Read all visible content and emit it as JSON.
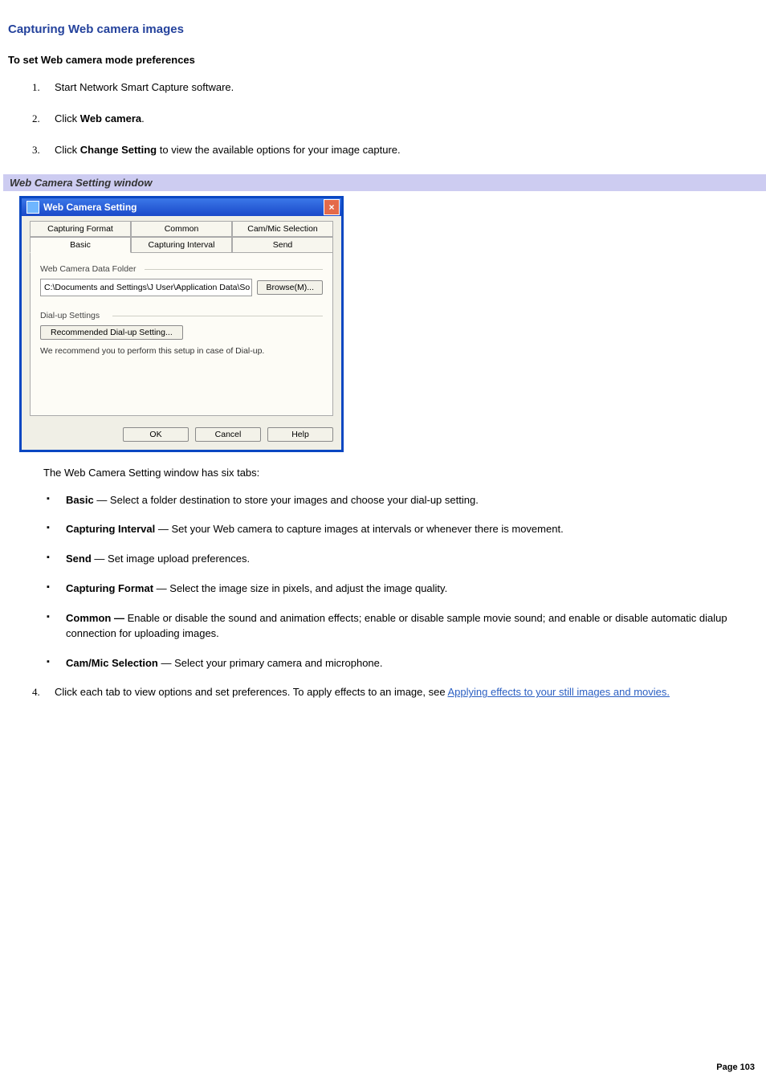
{
  "page": {
    "title": "Capturing Web camera images",
    "subhead": "To set Web camera mode preferences",
    "footer": "Page 103"
  },
  "steps": {
    "s1": "Start Network Smart Capture software.",
    "s2_pre": "Click ",
    "s2_bold": "Web camera",
    "s2_post": ".",
    "s3_pre": "Click ",
    "s3_bold": "Change Setting",
    "s3_post": " to view the available options for your image capture.",
    "s4_pre": "Click each tab to view options and set preferences. To apply effects to an image, see ",
    "s4_link": "Applying effects to your still images and movies."
  },
  "caption": "Web Camera Setting window",
  "dialog": {
    "title": "Web Camera Setting",
    "tabs": {
      "capturing_format": "Capturing Format",
      "common": "Common",
      "cam_mic": "Cam/Mic Selection",
      "basic": "Basic",
      "capturing_interval": "Capturing Interval",
      "send": "Send"
    },
    "group1_label": "Web Camera Data Folder",
    "path_value": "C:\\Documents and Settings\\J User\\Application Data\\So",
    "browse_btn": "Browse(M)...",
    "group2_label": "Dial-up Settings",
    "dialup_btn": "Recommended Dial-up Setting...",
    "dialup_note": "We recommend you to perform this setup in case of Dial-up.",
    "ok": "OK",
    "cancel": "Cancel",
    "help": "Help",
    "close_x": "×"
  },
  "tabs_intro": "The Web Camera Setting window has six tabs:",
  "bullets": {
    "b1_bold": "Basic",
    "b1_text": " — Select a folder destination to store your images and choose your dial-up setting.",
    "b2_bold": "Capturing Interval",
    "b2_text": " — Set your Web camera to capture images at intervals or whenever there is movement.",
    "b3_bold": "Send",
    "b3_text": " — Set image upload preferences.",
    "b4_bold": "Capturing Format",
    "b4_text": " — Select the image size in pixels, and adjust the image quality.",
    "b5_bold": "Common — ",
    "b5_text": "Enable or disable the sound and animation effects; enable or disable sample movie sound; and enable or disable automatic dialup connection for uploading images.",
    "b6_bold": "Cam/Mic Selection",
    "b6_text": " — Select your primary camera and microphone."
  }
}
